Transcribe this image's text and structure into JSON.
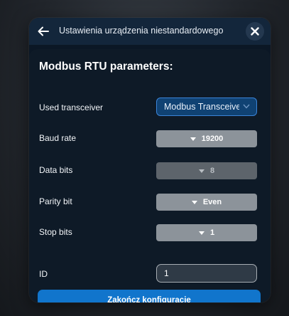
{
  "dialog": {
    "title": "Ustawienia urządzenia niestandardowego",
    "back_icon": "arrow-left-icon",
    "close_icon": "close-icon"
  },
  "section": {
    "title": "Modbus RTU parameters:"
  },
  "fields": {
    "transceiver": {
      "label": "Used transceiver",
      "value": "Modbus Transceiver"
    },
    "baud_rate": {
      "label": "Baud rate",
      "value": "19200"
    },
    "data_bits": {
      "label": "Data bits",
      "value": "8"
    },
    "parity_bit": {
      "label": "Parity bit",
      "value": "Even"
    },
    "stop_bits": {
      "label": "Stop bits",
      "value": "1"
    },
    "id": {
      "label": "ID",
      "value": "1"
    }
  },
  "actions": {
    "finish_label": "Zakończ konfigurację"
  },
  "colors": {
    "accent": "#1175cc",
    "select_blue": "#104273",
    "select_grey": "#8c939a",
    "select_disabled": "#5d646b"
  }
}
